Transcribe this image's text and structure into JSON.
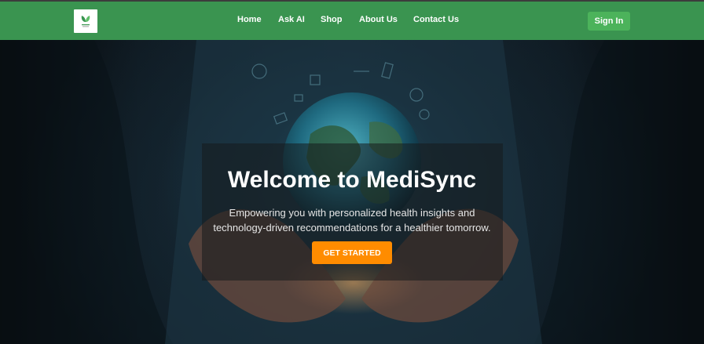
{
  "nav": {
    "logo_icon": "medisync-leaf-logo",
    "links": [
      {
        "label": "Home"
      },
      {
        "label": "Ask AI"
      },
      {
        "label": "Shop"
      },
      {
        "label": "About Us"
      },
      {
        "label": "Contact Us"
      }
    ],
    "signin_label": "Sign In"
  },
  "hero": {
    "title": "Welcome to MediSync",
    "subtitle": "Empowering you with personalized health insights and technology-driven recommendations for a healthier tomorrow.",
    "cta_label": "GET STARTED",
    "background_image": "doctor-hands-holding-glowing-globe"
  },
  "colors": {
    "nav_bg": "#3a9450",
    "signin_bg": "#4cb35b",
    "cta_bg": "#ff8c00"
  }
}
